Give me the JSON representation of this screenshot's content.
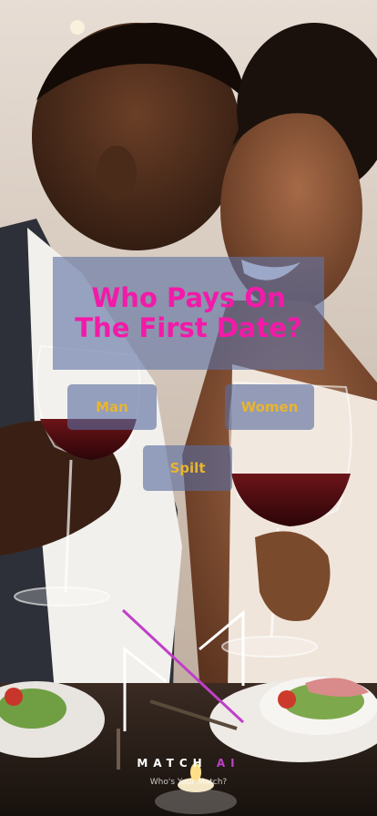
{
  "poll": {
    "question": "Who Pays On The First Date?",
    "options": [
      {
        "label": "Man"
      },
      {
        "label": "Women"
      },
      {
        "label": "Spilt"
      }
    ]
  },
  "brand": {
    "name_main": "MATCH",
    "name_suffix": "AI",
    "tagline": "Who's Your Match?"
  },
  "colors": {
    "title": "#f21aa8",
    "option_text": "#e9b52f",
    "panel": "#5f73a5",
    "logo_accent": "#c03fc8"
  }
}
